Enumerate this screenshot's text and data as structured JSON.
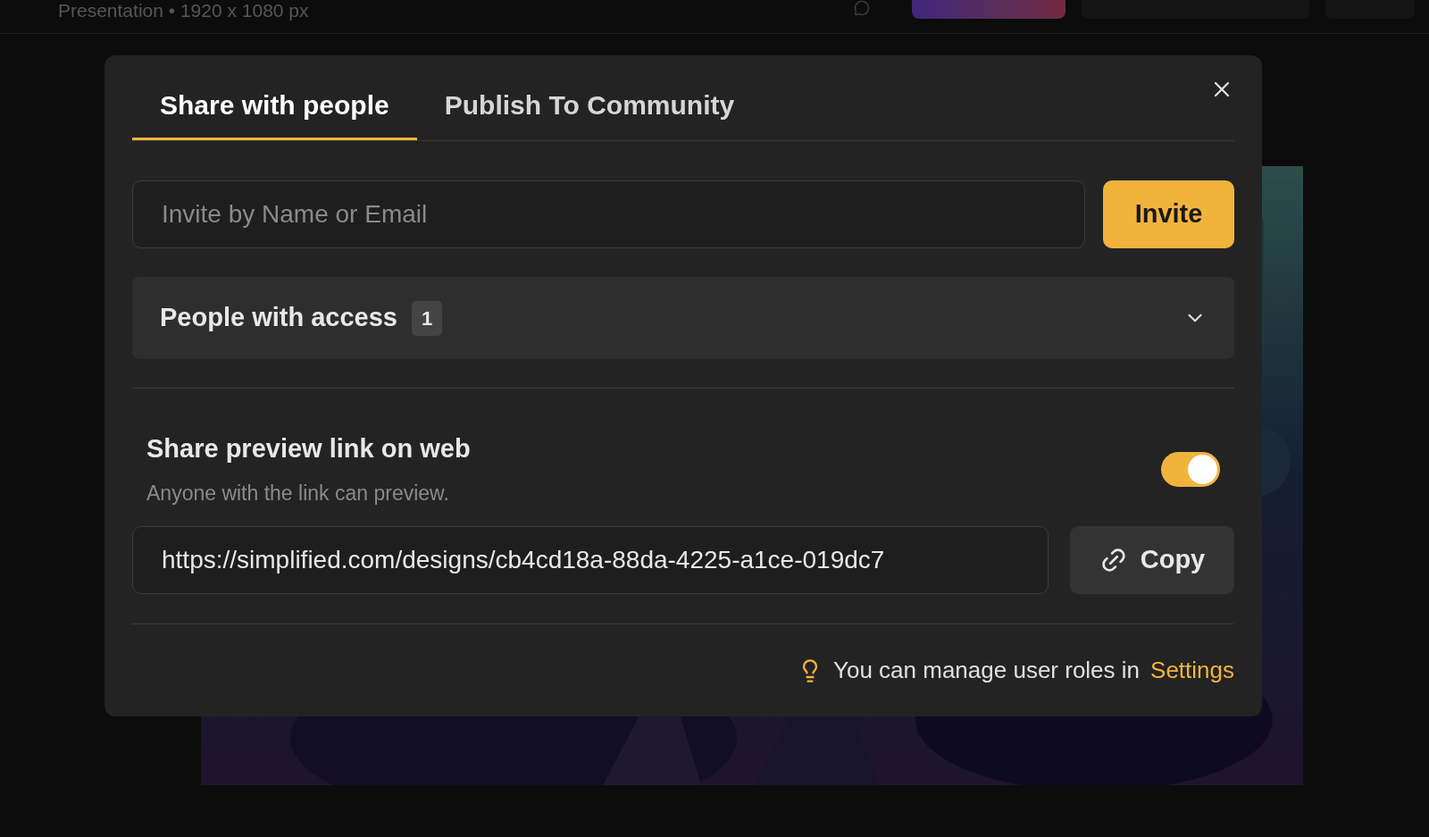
{
  "header": {
    "title": "Presentation • 1920 x 1080 px"
  },
  "dialog": {
    "tabs": [
      {
        "label": "Share with people",
        "selected": true
      },
      {
        "label": "Publish To Community",
        "selected": false
      }
    ],
    "invite": {
      "placeholder": "Invite by Name or Email",
      "button": "Invite"
    },
    "access": {
      "label": "People with access",
      "count": "1",
      "expanded": false
    },
    "preview": {
      "title": "Share preview link on web",
      "subtitle": "Anyone with the link can preview.",
      "on": true
    },
    "link": {
      "value": "https://simplified.com/designs/cb4cd18a-88da-4225-a1ce-019dc7",
      "button": "Copy"
    },
    "footer": {
      "text": "You can manage user roles in",
      "link": "Settings"
    }
  }
}
